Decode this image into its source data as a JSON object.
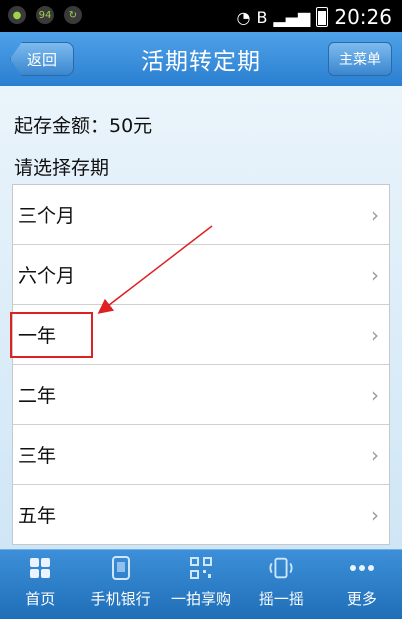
{
  "status_bar": {
    "time": "20:26",
    "left_icons": [
      "app-icon",
      "94",
      "app-icon"
    ],
    "right_icons": [
      "wifi-icon",
      "B",
      "signal-icon",
      "battery-icon"
    ]
  },
  "header": {
    "back_label": "返回",
    "title": "活期转定期",
    "menu_label": "主菜单"
  },
  "content": {
    "amount_text": "起存金额：50元",
    "section_title": "请选择存期",
    "terms": [
      {
        "label": "三个月"
      },
      {
        "label": "六个月"
      },
      {
        "label": "一年"
      },
      {
        "label": "二年"
      },
      {
        "label": "三年"
      },
      {
        "label": "五年"
      }
    ],
    "highlighted_term": "一年"
  },
  "tabbar": {
    "items": [
      {
        "label": "首页",
        "icon": "grid-icon"
      },
      {
        "label": "手机银行",
        "icon": "phone-icon"
      },
      {
        "label": "一拍享购",
        "icon": "qr-icon"
      },
      {
        "label": "摇一摇",
        "icon": "shake-icon"
      },
      {
        "label": "更多",
        "icon": "more-icon"
      }
    ]
  },
  "colors": {
    "header_blue": "#2a7fd0",
    "annotation_red": "#d22"
  }
}
